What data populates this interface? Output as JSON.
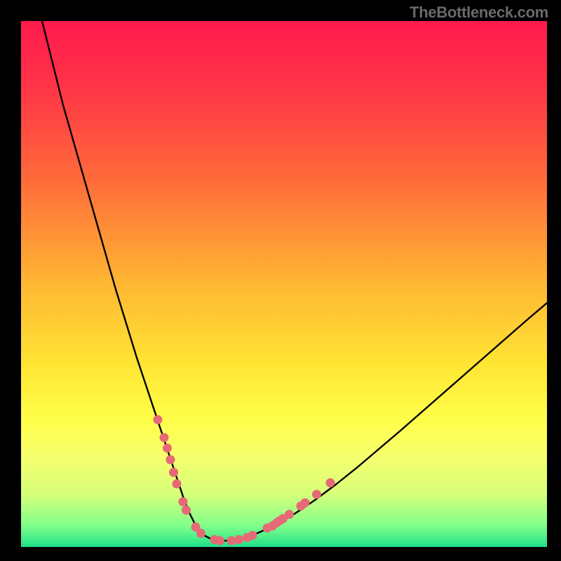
{
  "watermark": "TheBottleneck.com",
  "chart_data": {
    "type": "line",
    "title": "",
    "xlabel": "",
    "ylabel": "",
    "xlim": [
      0,
      100
    ],
    "ylim": [
      0,
      100
    ],
    "gradient_stops": [
      {
        "pct": 0,
        "color": "#ff1a4d"
      },
      {
        "pct": 12,
        "color": "#ff3347"
      },
      {
        "pct": 30,
        "color": "#ff6a3a"
      },
      {
        "pct": 50,
        "color": "#ffb733"
      },
      {
        "pct": 65,
        "color": "#ffe433"
      },
      {
        "pct": 76,
        "color": "#ffff4a"
      },
      {
        "pct": 83,
        "color": "#f6ff6e"
      },
      {
        "pct": 90,
        "color": "#d6ff7a"
      },
      {
        "pct": 96,
        "color": "#7fff8a"
      },
      {
        "pct": 100,
        "color": "#1fe08a"
      }
    ],
    "series": [
      {
        "name": "bottleneck-curve",
        "x": [
          4,
          6,
          8,
          10,
          12,
          14,
          16,
          18,
          20,
          22,
          24,
          26,
          28,
          30,
          31,
          32,
          33,
          34,
          35,
          36,
          38,
          40,
          42,
          44,
          48,
          52,
          56,
          60,
          64,
          68,
          72,
          76,
          80,
          84,
          88,
          92,
          96,
          100
        ],
        "y": [
          100,
          92,
          84,
          77,
          70,
          63,
          56,
          49,
          42.5,
          36,
          30,
          24,
          18,
          12,
          9,
          6.5,
          4.5,
          3,
          2.1,
          1.6,
          1.2,
          1.2,
          1.6,
          2.2,
          4.0,
          6.3,
          9.0,
          12.0,
          15.2,
          18.6,
          22.0,
          25.5,
          29.0,
          32.5,
          36.0,
          39.5,
          43.0,
          46.4
        ]
      }
    ],
    "markers": {
      "name": "highlight-dots",
      "color": "#e66a76",
      "radius": 6.5,
      "points": [
        {
          "x": 26.0,
          "y": 24.2
        },
        {
          "x": 27.2,
          "y": 20.8
        },
        {
          "x": 27.8,
          "y": 18.8
        },
        {
          "x": 28.4,
          "y": 16.6
        },
        {
          "x": 29.0,
          "y": 14.2
        },
        {
          "x": 29.6,
          "y": 12.0
        },
        {
          "x": 30.8,
          "y": 8.6
        },
        {
          "x": 31.4,
          "y": 7.0
        },
        {
          "x": 33.2,
          "y": 3.8
        },
        {
          "x": 34.2,
          "y": 2.6
        },
        {
          "x": 36.8,
          "y": 1.4
        },
        {
          "x": 37.8,
          "y": 1.2
        },
        {
          "x": 40.0,
          "y": 1.2
        },
        {
          "x": 41.4,
          "y": 1.4
        },
        {
          "x": 43.0,
          "y": 1.8
        },
        {
          "x": 44.0,
          "y": 2.2
        },
        {
          "x": 46.8,
          "y": 3.6
        },
        {
          "x": 47.8,
          "y": 4.0
        },
        {
          "x": 48.6,
          "y": 4.6
        },
        {
          "x": 49.2,
          "y": 5.0
        },
        {
          "x": 49.8,
          "y": 5.4
        },
        {
          "x": 51.0,
          "y": 6.2
        },
        {
          "x": 53.2,
          "y": 7.8
        },
        {
          "x": 54.0,
          "y": 8.4
        },
        {
          "x": 56.2,
          "y": 10.0
        },
        {
          "x": 58.8,
          "y": 12.2
        }
      ]
    }
  }
}
